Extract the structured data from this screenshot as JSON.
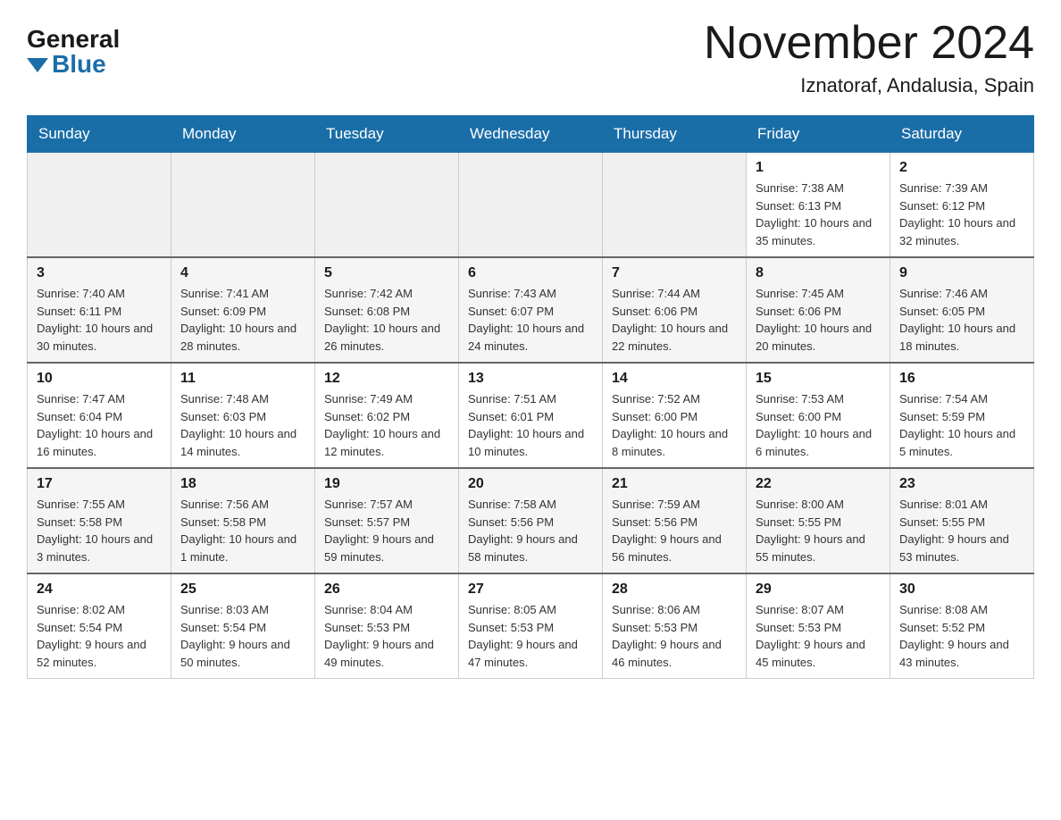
{
  "header": {
    "logo": {
      "general": "General",
      "blue": "Blue"
    },
    "title": "November 2024",
    "location": "Iznatoraf, Andalusia, Spain"
  },
  "calendar": {
    "days_of_week": [
      "Sunday",
      "Monday",
      "Tuesday",
      "Wednesday",
      "Thursday",
      "Friday",
      "Saturday"
    ],
    "weeks": [
      {
        "days": [
          {
            "number": "",
            "info": ""
          },
          {
            "number": "",
            "info": ""
          },
          {
            "number": "",
            "info": ""
          },
          {
            "number": "",
            "info": ""
          },
          {
            "number": "",
            "info": ""
          },
          {
            "number": "1",
            "info": "Sunrise: 7:38 AM\nSunset: 6:13 PM\nDaylight: 10 hours and 35 minutes."
          },
          {
            "number": "2",
            "info": "Sunrise: 7:39 AM\nSunset: 6:12 PM\nDaylight: 10 hours and 32 minutes."
          }
        ]
      },
      {
        "days": [
          {
            "number": "3",
            "info": "Sunrise: 7:40 AM\nSunset: 6:11 PM\nDaylight: 10 hours and 30 minutes."
          },
          {
            "number": "4",
            "info": "Sunrise: 7:41 AM\nSunset: 6:09 PM\nDaylight: 10 hours and 28 minutes."
          },
          {
            "number": "5",
            "info": "Sunrise: 7:42 AM\nSunset: 6:08 PM\nDaylight: 10 hours and 26 minutes."
          },
          {
            "number": "6",
            "info": "Sunrise: 7:43 AM\nSunset: 6:07 PM\nDaylight: 10 hours and 24 minutes."
          },
          {
            "number": "7",
            "info": "Sunrise: 7:44 AM\nSunset: 6:06 PM\nDaylight: 10 hours and 22 minutes."
          },
          {
            "number": "8",
            "info": "Sunrise: 7:45 AM\nSunset: 6:06 PM\nDaylight: 10 hours and 20 minutes."
          },
          {
            "number": "9",
            "info": "Sunrise: 7:46 AM\nSunset: 6:05 PM\nDaylight: 10 hours and 18 minutes."
          }
        ]
      },
      {
        "days": [
          {
            "number": "10",
            "info": "Sunrise: 7:47 AM\nSunset: 6:04 PM\nDaylight: 10 hours and 16 minutes."
          },
          {
            "number": "11",
            "info": "Sunrise: 7:48 AM\nSunset: 6:03 PM\nDaylight: 10 hours and 14 minutes."
          },
          {
            "number": "12",
            "info": "Sunrise: 7:49 AM\nSunset: 6:02 PM\nDaylight: 10 hours and 12 minutes."
          },
          {
            "number": "13",
            "info": "Sunrise: 7:51 AM\nSunset: 6:01 PM\nDaylight: 10 hours and 10 minutes."
          },
          {
            "number": "14",
            "info": "Sunrise: 7:52 AM\nSunset: 6:00 PM\nDaylight: 10 hours and 8 minutes."
          },
          {
            "number": "15",
            "info": "Sunrise: 7:53 AM\nSunset: 6:00 PM\nDaylight: 10 hours and 6 minutes."
          },
          {
            "number": "16",
            "info": "Sunrise: 7:54 AM\nSunset: 5:59 PM\nDaylight: 10 hours and 5 minutes."
          }
        ]
      },
      {
        "days": [
          {
            "number": "17",
            "info": "Sunrise: 7:55 AM\nSunset: 5:58 PM\nDaylight: 10 hours and 3 minutes."
          },
          {
            "number": "18",
            "info": "Sunrise: 7:56 AM\nSunset: 5:58 PM\nDaylight: 10 hours and 1 minute."
          },
          {
            "number": "19",
            "info": "Sunrise: 7:57 AM\nSunset: 5:57 PM\nDaylight: 9 hours and 59 minutes."
          },
          {
            "number": "20",
            "info": "Sunrise: 7:58 AM\nSunset: 5:56 PM\nDaylight: 9 hours and 58 minutes."
          },
          {
            "number": "21",
            "info": "Sunrise: 7:59 AM\nSunset: 5:56 PM\nDaylight: 9 hours and 56 minutes."
          },
          {
            "number": "22",
            "info": "Sunrise: 8:00 AM\nSunset: 5:55 PM\nDaylight: 9 hours and 55 minutes."
          },
          {
            "number": "23",
            "info": "Sunrise: 8:01 AM\nSunset: 5:55 PM\nDaylight: 9 hours and 53 minutes."
          }
        ]
      },
      {
        "days": [
          {
            "number": "24",
            "info": "Sunrise: 8:02 AM\nSunset: 5:54 PM\nDaylight: 9 hours and 52 minutes."
          },
          {
            "number": "25",
            "info": "Sunrise: 8:03 AM\nSunset: 5:54 PM\nDaylight: 9 hours and 50 minutes."
          },
          {
            "number": "26",
            "info": "Sunrise: 8:04 AM\nSunset: 5:53 PM\nDaylight: 9 hours and 49 minutes."
          },
          {
            "number": "27",
            "info": "Sunrise: 8:05 AM\nSunset: 5:53 PM\nDaylight: 9 hours and 47 minutes."
          },
          {
            "number": "28",
            "info": "Sunrise: 8:06 AM\nSunset: 5:53 PM\nDaylight: 9 hours and 46 minutes."
          },
          {
            "number": "29",
            "info": "Sunrise: 8:07 AM\nSunset: 5:53 PM\nDaylight: 9 hours and 45 minutes."
          },
          {
            "number": "30",
            "info": "Sunrise: 8:08 AM\nSunset: 5:52 PM\nDaylight: 9 hours and 43 minutes."
          }
        ]
      }
    ]
  }
}
